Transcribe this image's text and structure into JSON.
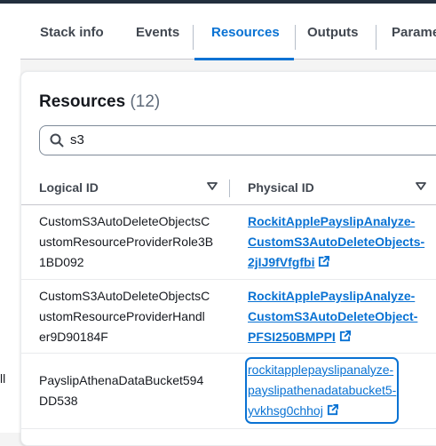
{
  "tabs": [
    "Stack info",
    "Events",
    "Resources",
    "Outputs",
    "Parame"
  ],
  "left_partial_text": "ll",
  "panel": {
    "title": "Resources",
    "count": "(12)"
  },
  "search": {
    "value": "s3"
  },
  "table": {
    "headers": {
      "logical": "Logical ID",
      "physical": "Physical ID"
    },
    "rows": [
      {
        "logical": [
          "CustomS3AutoDeleteObjectsC",
          "ustomResourceProviderRole3B",
          "1BD092"
        ],
        "physical": [
          "RockitApplePayslipAnalyze-",
          "CustomS3AutoDeleteObjects-",
          "2jIJ9fVfgfbi"
        ]
      },
      {
        "logical": [
          "CustomS3AutoDeleteObjectsC",
          "ustomResourceProviderHandl",
          "er9D90184F"
        ],
        "physical": [
          "RockitApplePayslipAnalyze-",
          "CustomS3AutoDeleteObject-",
          "PFSI250BMPPI"
        ]
      },
      {
        "logical": [
          "PayslipAthenaDataBucket594",
          "DD538"
        ],
        "physical": [
          "rockitapplepayslipanalyze-",
          "payslipathenadatabucket5-",
          "yvkhsg0chhoj"
        ]
      }
    ]
  },
  "icons": {
    "search": "search-icon",
    "sort": "caret-down-icon",
    "external": "external-link-icon"
  },
  "colors": {
    "accent": "#0972d3",
    "text": "#16191f",
    "muted": "#5f6b7a",
    "header_bar": "#232f3e"
  }
}
